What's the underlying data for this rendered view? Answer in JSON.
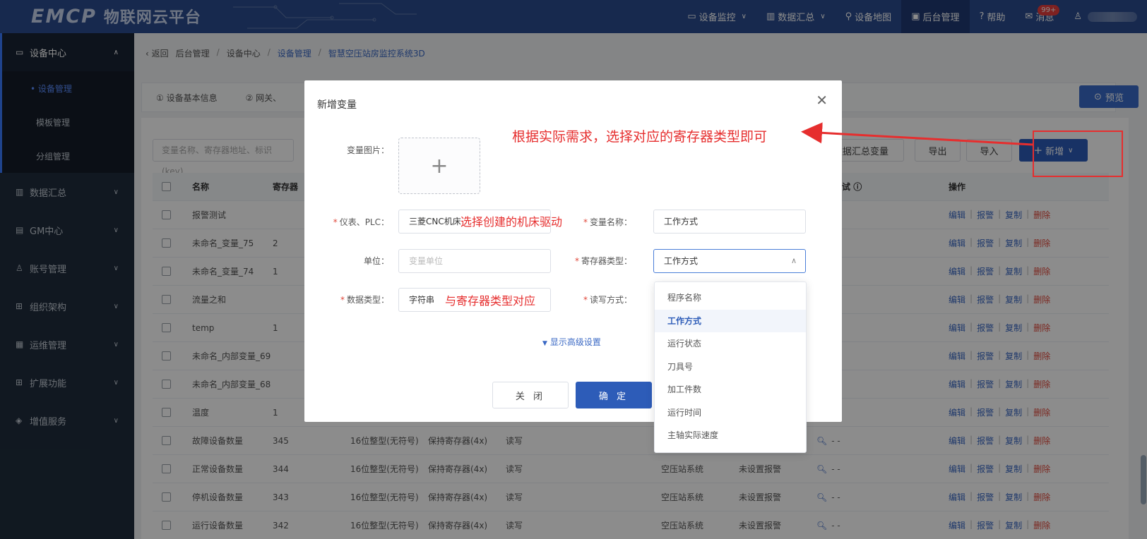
{
  "header": {
    "logo": "EMCP",
    "logo_sub": "物联网云平台",
    "nav": [
      {
        "icon": "monitor-icon",
        "label": "设备监控",
        "chevron": true
      },
      {
        "icon": "chart-icon",
        "label": "数据汇总",
        "chevron": true
      },
      {
        "icon": "map-pin-icon",
        "label": "设备地图",
        "chevron": false
      },
      {
        "icon": "admin-icon",
        "label": "后台管理",
        "chevron": false,
        "active": true
      },
      {
        "icon": "help-icon",
        "label": "帮助",
        "chevron": false
      },
      {
        "icon": "message-icon",
        "label": "消息",
        "chevron": false,
        "badge": "99+"
      }
    ]
  },
  "sidebar": {
    "groups": [
      {
        "label": "设备中心",
        "open": true,
        "children": [
          {
            "label": "• 设备管理",
            "active": true
          },
          {
            "label": "模板管理"
          },
          {
            "label": "分组管理"
          }
        ]
      },
      {
        "label": "数据汇总"
      },
      {
        "label": "GM中心"
      },
      {
        "label": "账号管理"
      },
      {
        "label": "组织架构"
      },
      {
        "label": "运维管理"
      },
      {
        "label": "扩展功能"
      },
      {
        "label": "增值服务"
      }
    ]
  },
  "breadcrumb": {
    "back": "返回",
    "items": [
      "后台管理",
      "设备中心",
      "设备管理",
      "智慧空压站房监控系统3D"
    ]
  },
  "tabs": [
    "① 设备基本信息",
    "② 网关、"
  ],
  "preview_label": "预览",
  "toolbar": {
    "search_placeholder": "变量名称、寄存器地址、标识(key)",
    "summary_btn": "数据汇总变量",
    "export_btn": "导出",
    "import_btn": "导入",
    "add_btn": "新增"
  },
  "table": {
    "headers": {
      "name": "名称",
      "reg": "寄存器",
      "debug": "数据调试",
      "ops": "操作"
    },
    "ops": [
      "编辑",
      "报警",
      "复制",
      "删除"
    ],
    "debug_value": "- -",
    "rows": [
      {
        "name": "报警测试",
        "addr": "",
        "dtype": "",
        "rtype": "",
        "rw": "",
        "group": "",
        "alarm": ""
      },
      {
        "name": "未命名_变量_75",
        "addr": "2",
        "dtype": "",
        "rtype": "",
        "rw": "",
        "group": "",
        "alarm": ""
      },
      {
        "name": "未命名_变量_74",
        "addr": "1",
        "dtype": "",
        "rtype": "",
        "rw": "",
        "group": "",
        "alarm": ""
      },
      {
        "name": "流量之和",
        "addr": "",
        "dtype": "",
        "rtype": "",
        "rw": "",
        "group": "",
        "alarm": ""
      },
      {
        "name": "temp",
        "addr": "1",
        "dtype": "",
        "rtype": "",
        "rw": "",
        "group": "",
        "alarm": ""
      },
      {
        "name": "未命名_内部变量_69",
        "addr": "",
        "dtype": "",
        "rtype": "",
        "rw": "",
        "group": "",
        "alarm": ""
      },
      {
        "name": "未命名_内部变量_68",
        "addr": "",
        "dtype": "",
        "rtype": "",
        "rw": "",
        "group": "",
        "alarm": ""
      },
      {
        "name": "温度",
        "addr": "1",
        "dtype": "",
        "rtype": "",
        "rw": "",
        "group": "",
        "alarm": ""
      },
      {
        "name": "故障设备数量",
        "addr": "345",
        "dtype": "16位整型(无符号)",
        "rtype": "保持寄存器(4x)",
        "rw": "读写",
        "group": "",
        "alarm": ""
      },
      {
        "name": "正常设备数量",
        "addr": "344",
        "dtype": "16位整型(无符号)",
        "rtype": "保持寄存器(4x)",
        "rw": "读写",
        "group": "空压站系统",
        "alarm": "未设置报警"
      },
      {
        "name": "停机设备数量",
        "addr": "343",
        "dtype": "16位整型(无符号)",
        "rtype": "保持寄存器(4x)",
        "rw": "读写",
        "group": "空压站系统",
        "alarm": "未设置报警"
      },
      {
        "name": "运行设备数量",
        "addr": "342",
        "dtype": "16位整型(无符号)",
        "rtype": "保持寄存器(4x)",
        "rw": "读写",
        "group": "空压站系统",
        "alarm": "未设置报警"
      }
    ]
  },
  "modal": {
    "title": "新增变量",
    "fields": {
      "image_label": "变量图片：",
      "plc_label": "仪表、PLC：",
      "plc_value": "三菱CNC机床",
      "name_label": "变量名称：",
      "name_value": "工作方式",
      "unit_label": "单位：",
      "unit_placeholder": "变量单位",
      "regtype_label": "寄存器类型：",
      "regtype_value": "工作方式",
      "dtype_label": "数据类型：",
      "dtype_value": "字符串",
      "rw_label": "读写方式："
    },
    "advanced": "显示高级设置",
    "close_btn": "关 闭",
    "ok_btn": "确 定"
  },
  "dropdown": {
    "options": [
      "程序名称",
      "工作方式",
      "运行状态",
      "刀具号",
      "加工件数",
      "运行时间",
      "主轴实际速度"
    ],
    "selected": "工作方式"
  },
  "annotations": {
    "top": "根据实际需求，选择对应的寄存器类型即可",
    "plc": "选择创建的机床驱动",
    "dtype": "与寄存器类型对应"
  },
  "colors": {
    "header": "#2b4c8e",
    "sidebar": "#1f2d3d",
    "primary": "#2d5cb8",
    "annotation": "#e62e2e",
    "danger": "#e0483b"
  }
}
